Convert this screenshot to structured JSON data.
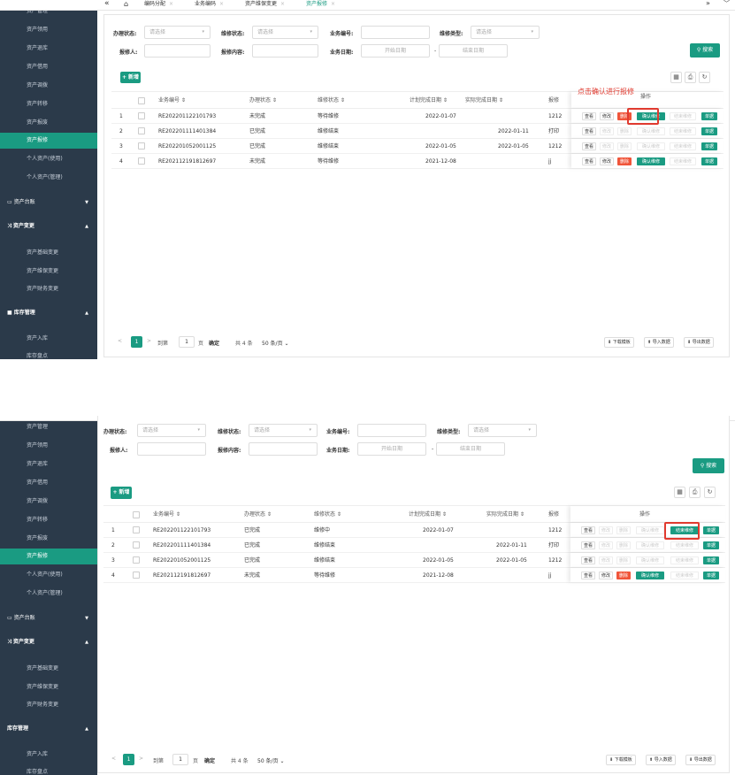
{
  "tabs": {
    "nav_prev": "«",
    "home": "⌂",
    "items": [
      "编码分配",
      "业务编码",
      "资产维保变更",
      "资产报修"
    ],
    "nav_next": "»",
    "dropdown": "﹀"
  },
  "sidebar": {
    "top_items": [
      "资产管理",
      "资产领用",
      "资产退库",
      "资产借用",
      "资产调拨",
      "资产转移",
      "资产报废",
      "资产报修",
      "个人资产(使用)",
      "个人资产(管理)"
    ],
    "group_ledger": "资产台账",
    "group_change": "资产变更",
    "change_items": [
      "资产基础变更",
      "资产维保变更",
      "资产财务变更"
    ],
    "group_stock": "库存管理",
    "stock_items": [
      "资产入库",
      "库存盘点"
    ]
  },
  "filters": {
    "status_label": "办理状态:",
    "status_placeholder": "请选择",
    "repair_status_label": "维修状态:",
    "repair_status_placeholder": "请选择",
    "biz_no_label": "业务编号:",
    "repair_type_label": "维修类型:",
    "repair_type_placeholder": "请选择",
    "reporter_label": "报修人:",
    "content_label": "报修内容:",
    "date_label": "业务日期:",
    "date_start": "开始日期",
    "date_sep": "-",
    "date_end": "结束日期",
    "search_button": "搜索"
  },
  "toolbar": {
    "new_button": "+ 新增"
  },
  "table": {
    "columns": [
      "业务编号 ⇕",
      "办理状态 ⇕",
      "维修状态 ⇕",
      "计划完成日期 ⇕",
      "实际完成日期 ⇕",
      "报修"
    ],
    "op_header": "操作",
    "rows_before": [
      {
        "no": "1",
        "code": "RE202201122101793",
        "status": "未完成",
        "repair": "等待维修",
        "plan": "2022-01-07",
        "actual": "",
        "reporter": "1212"
      },
      {
        "no": "2",
        "code": "RE202201111401384",
        "status": "已完成",
        "repair": "维修结束",
        "plan": "",
        "actual": "2022-01-11",
        "reporter": "打印"
      },
      {
        "no": "3",
        "code": "RE202201052001125",
        "status": "已完成",
        "repair": "维修结束",
        "plan": "2022-01-05",
        "actual": "2022-01-05",
        "reporter": "1212"
      },
      {
        "no": "4",
        "code": "RE202112191812697",
        "status": "未完成",
        "repair": "等待维修",
        "plan": "2021-12-08",
        "actual": "",
        "reporter": "jj"
      }
    ],
    "rows_after": [
      {
        "no": "1",
        "code": "RE202201122101793",
        "status": "已完成",
        "repair": "维修中",
        "plan": "2022-01-07",
        "actual": "",
        "reporter": "1212"
      },
      {
        "no": "2",
        "code": "RE202201111401384",
        "status": "已完成",
        "repair": "维修结束",
        "plan": "",
        "actual": "2022-01-11",
        "reporter": "打印"
      },
      {
        "no": "3",
        "code": "RE202201052001125",
        "status": "已完成",
        "repair": "维修结束",
        "plan": "2022-01-05",
        "actual": "2022-01-05",
        "reporter": "1212"
      },
      {
        "no": "4",
        "code": "RE202112191812697",
        "status": "未完成",
        "repair": "等待维修",
        "plan": "2021-12-08",
        "actual": "",
        "reporter": "jj"
      }
    ],
    "ops": {
      "view": "查看",
      "edit": "修改",
      "delete": "删除",
      "confirm": "确认维修",
      "finish": "结束维修",
      "document": "单据"
    }
  },
  "annotation": "点击确认进行报修",
  "pager": {
    "prev": "<",
    "current": "1",
    "next": ">",
    "goto": "到第",
    "page_input": "1",
    "page_unit": "页",
    "confirm": "确定",
    "total": "共 4 条",
    "per_page": "50 条/页",
    "download_template": "⬇ 下载模板",
    "import": "⬆ 导入数据",
    "export": "⬇ 导出数据"
  },
  "colors": {
    "accent": "#1a9b82",
    "danger": "#f0553a",
    "highlight": "#e03a2f",
    "sidebar_bg": "#2b3a4a"
  }
}
